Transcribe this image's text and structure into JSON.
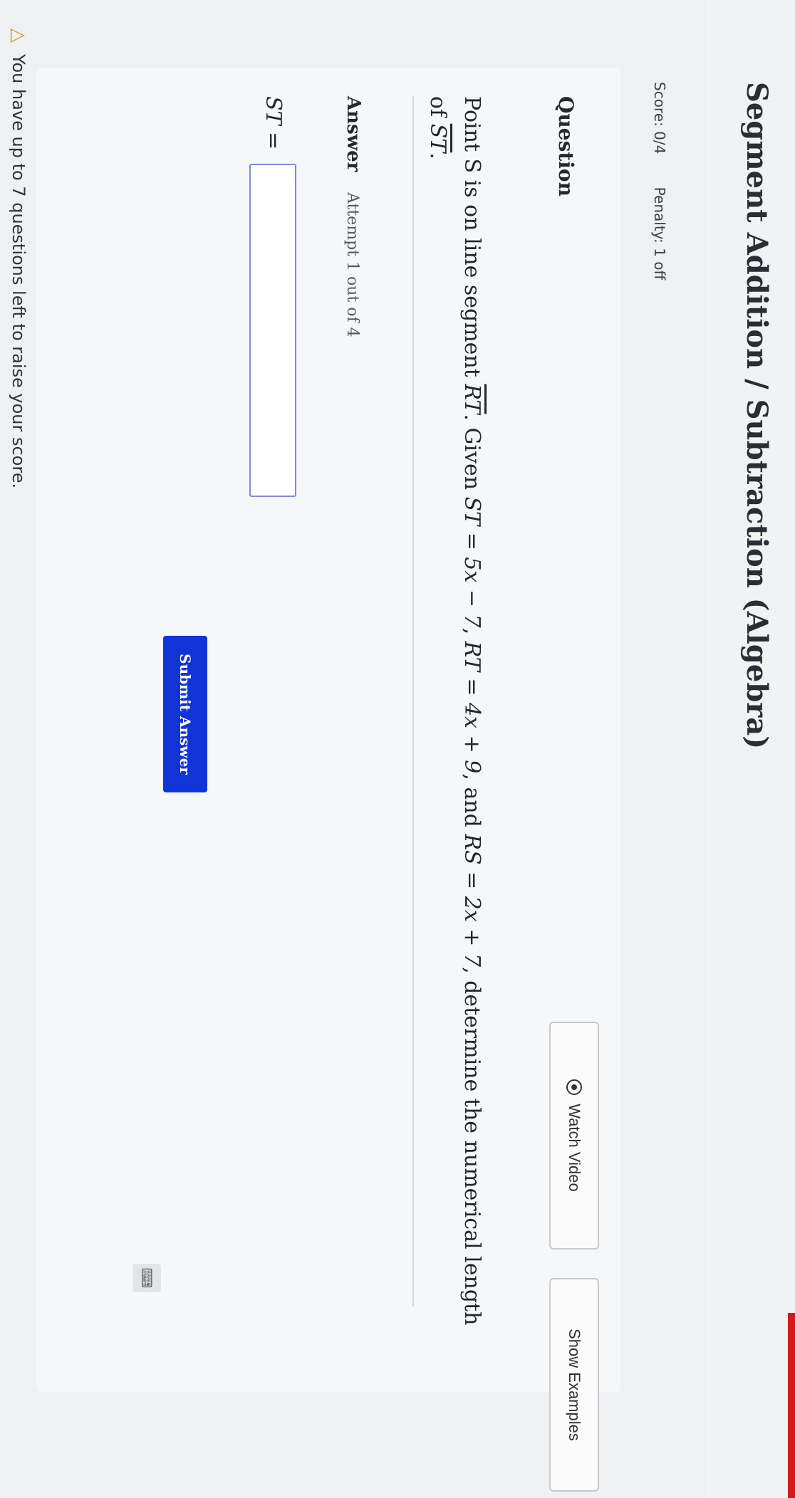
{
  "header": {
    "title": "Segment Addition / Subtraction (Algebra)"
  },
  "score": {
    "score_text": "Score: 0/4",
    "penalty_text": "Penalty: 1 off"
  },
  "question": {
    "heading": "Question",
    "watch_video_label": "Watch Video",
    "show_examples_label": "Show Examples",
    "text_part1": "Point S is on line segment ",
    "seg_rt": "RT",
    "text_part2": ". Given ",
    "st_expr": "ST = 5x − 7",
    "sep1": ", ",
    "rt_expr": "RT = 4x + 9",
    "sep2": ", and ",
    "rs_expr": "RS = 2x + 7",
    "text_part3": ", determine the numerical length of ",
    "seg_st": "ST",
    "text_part4": "."
  },
  "answer": {
    "heading": "Answer",
    "attempt_text": "Attempt 1 out of 4",
    "input_label": "ST =",
    "input_value": "",
    "submit_label": "Submit Answer"
  },
  "footer": {
    "warning_text": "You have up to 7 questions left to raise your score."
  },
  "icons": {
    "play": "play-circle-icon",
    "warning": "warning-triangle-icon",
    "calculator": "keyboard-icon"
  },
  "colors": {
    "submit_bg": "#1034d6",
    "input_border": "#7f8bd6",
    "warning": "#c9a325"
  }
}
